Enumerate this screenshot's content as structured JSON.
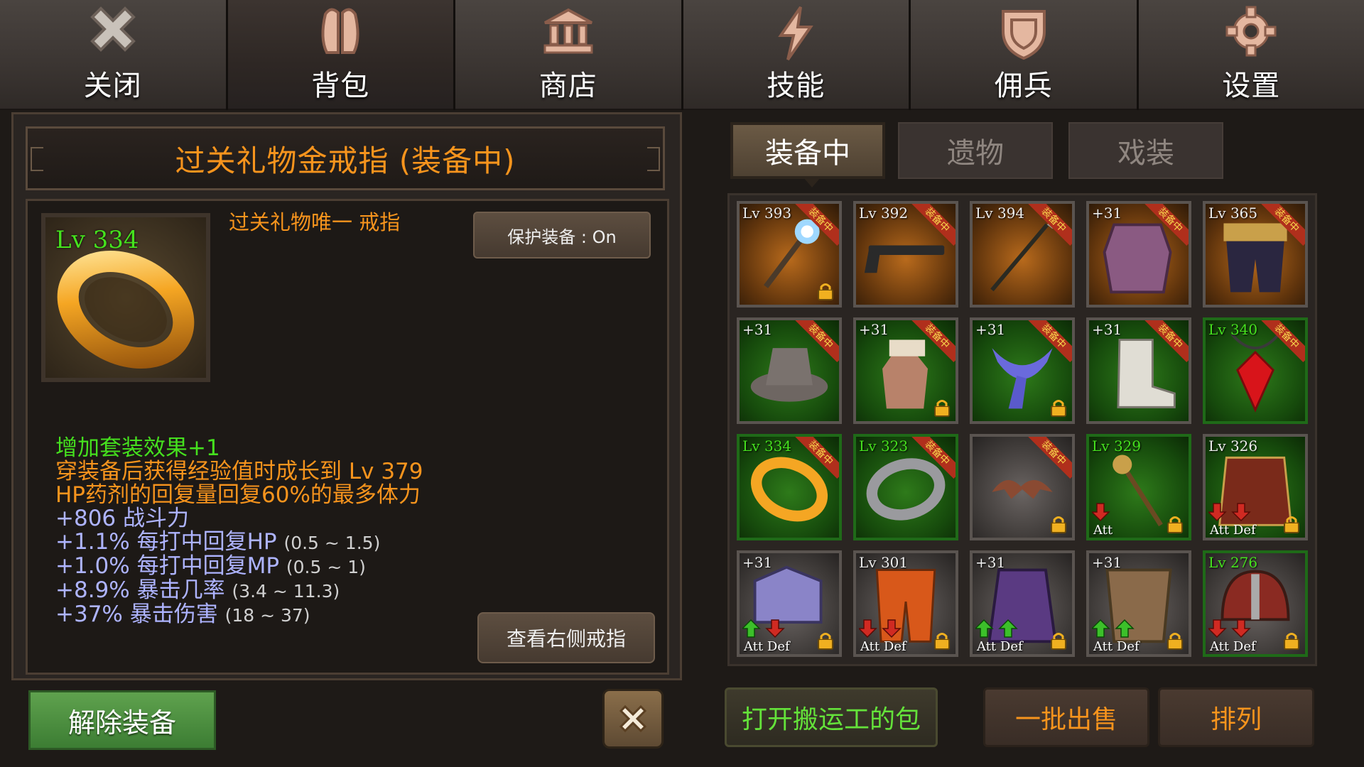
{
  "nav": [
    {
      "label": "关闭",
      "icon": "close-icon"
    },
    {
      "label": "背包",
      "icon": "backpack-icon"
    },
    {
      "label": "商店",
      "icon": "shop-icon"
    },
    {
      "label": "技能",
      "icon": "lightning-icon"
    },
    {
      "label": "佣兵",
      "icon": "shield-icon"
    },
    {
      "label": "设置",
      "icon": "gear-icon"
    }
  ],
  "item": {
    "title": "过关礼物金戒指 (装备中)",
    "level": "Lv 334",
    "subtitle": "过关礼物唯一 戒指",
    "protect_label": "保护装备 : On",
    "stats": [
      {
        "text": "增加套装效果+1",
        "range": "",
        "color": "green"
      },
      {
        "text": "穿装备后获得经验值时成长到 Lv 379",
        "range": "",
        "color": "orange"
      },
      {
        "text": "HP药剂的回复量回复60%的最多体力",
        "range": "",
        "color": "orange"
      },
      {
        "text": "+806 战斗力",
        "range": "",
        "color": "blue"
      },
      {
        "text": "+1.1% 每打中回复HP",
        "range": "(0.5 ~ 1.5)",
        "color": "blue"
      },
      {
        "text": "+1.0% 每打中回复MP",
        "range": "(0.5 ~ 1)",
        "color": "blue"
      },
      {
        "text": "+8.9% 暴击几率",
        "range": "(3.4 ~ 11.3)",
        "color": "blue"
      },
      {
        "text": "+37% 暴击伤害",
        "range": "(18 ~ 37)",
        "color": "blue"
      }
    ],
    "view_right_label": "查看右侧戒指",
    "unequip_label": "解除装备"
  },
  "tabs": [
    {
      "label": "装备中",
      "active": true
    },
    {
      "label": "遗物",
      "active": false
    },
    {
      "label": "戏装",
      "active": false
    }
  ],
  "equipped_badge": "装备中",
  "slots": [
    {
      "level": "Lv 393",
      "lv_green": false,
      "badge": true,
      "lock": true,
      "icon": "magic-staff-icon",
      "bg": "orange",
      "border": "gray",
      "att": "",
      "def": ""
    },
    {
      "level": "Lv 392",
      "lv_green": false,
      "badge": true,
      "lock": false,
      "icon": "shotgun-icon",
      "bg": "orange",
      "border": "gray",
      "att": "",
      "def": ""
    },
    {
      "level": "Lv 394",
      "lv_green": false,
      "badge": true,
      "lock": false,
      "icon": "spear-icon",
      "bg": "orange",
      "border": "gray",
      "att": "",
      "def": ""
    },
    {
      "level": "+31",
      "lv_green": false,
      "badge": true,
      "lock": false,
      "icon": "chest-armor-icon",
      "bg": "orange",
      "border": "gray",
      "att": "",
      "def": ""
    },
    {
      "level": "Lv 365",
      "lv_green": false,
      "badge": true,
      "lock": false,
      "icon": "belt-pants-icon",
      "bg": "orange",
      "border": "gray",
      "att": "",
      "def": ""
    },
    {
      "level": "+31",
      "lv_green": false,
      "badge": true,
      "lock": false,
      "icon": "hat-icon",
      "bg": "green",
      "border": "gray",
      "att": "",
      "def": ""
    },
    {
      "level": "+31",
      "lv_green": false,
      "badge": true,
      "lock": true,
      "icon": "gloves-icon",
      "bg": "green",
      "border": "gray",
      "att": "",
      "def": ""
    },
    {
      "level": "+31",
      "lv_green": false,
      "badge": true,
      "lock": true,
      "icon": "scarf-icon",
      "bg": "green",
      "border": "gray",
      "att": "",
      "def": ""
    },
    {
      "level": "+31",
      "lv_green": false,
      "badge": true,
      "lock": false,
      "icon": "boots-icon",
      "bg": "green",
      "border": "gray",
      "att": "",
      "def": ""
    },
    {
      "level": "Lv 340",
      "lv_green": true,
      "badge": true,
      "lock": false,
      "icon": "red-gem-necklace-icon",
      "bg": "green",
      "border": "green",
      "att": "",
      "def": ""
    },
    {
      "level": "Lv 334",
      "lv_green": true,
      "badge": true,
      "lock": false,
      "icon": "gold-ring-icon",
      "bg": "green",
      "border": "green",
      "att": "",
      "def": ""
    },
    {
      "level": "Lv 323",
      "lv_green": true,
      "badge": true,
      "lock": false,
      "icon": "silver-ring-icon",
      "bg": "green",
      "border": "green",
      "att": "",
      "def": ""
    },
    {
      "level": "",
      "lv_green": false,
      "badge": true,
      "lock": true,
      "icon": "bat-wings-icon",
      "bg": "gray",
      "border": "gray",
      "att": "",
      "def": ""
    },
    {
      "level": "Lv 329",
      "lv_green": true,
      "badge": false,
      "lock": true,
      "icon": "mace-staff-icon",
      "bg": "green",
      "border": "green",
      "att": "Att",
      "def": "",
      "att_dir": "down"
    },
    {
      "level": "Lv 326",
      "lv_green": false,
      "badge": false,
      "lock": true,
      "icon": "red-coat-icon",
      "bg": "green",
      "border": "gray",
      "att": "Att",
      "def": "Def",
      "att_dir": "down",
      "def_dir": "down"
    },
    {
      "level": "+31",
      "lv_green": false,
      "badge": false,
      "lock": true,
      "icon": "shoulder-armor-icon",
      "bg": "gray",
      "border": "gray",
      "att": "Att",
      "def": "Def",
      "att_dir": "up",
      "def_dir": "down"
    },
    {
      "level": "Lv 301",
      "lv_green": false,
      "badge": false,
      "lock": true,
      "icon": "orange-pants-icon",
      "bg": "gray",
      "border": "gray",
      "att": "Att",
      "def": "Def",
      "att_dir": "down",
      "def_dir": "down"
    },
    {
      "level": "+31",
      "lv_green": false,
      "badge": false,
      "lock": true,
      "icon": "purple-robe-icon",
      "bg": "gray",
      "border": "gray",
      "att": "Att",
      "def": "Def",
      "att_dir": "up",
      "def_dir": "up"
    },
    {
      "level": "+31",
      "lv_green": false,
      "badge": false,
      "lock": true,
      "icon": "leather-armor-icon",
      "bg": "gray",
      "border": "gray",
      "att": "Att",
      "def": "Def",
      "att_dir": "up",
      "def_dir": "up"
    },
    {
      "level": "Lv 276",
      "lv_green": true,
      "badge": false,
      "lock": true,
      "icon": "helmet-icon",
      "bg": "gray",
      "border": "green",
      "att": "Att",
      "def": "Def",
      "att_dir": "down",
      "def_dir": "down"
    }
  ],
  "bottom": {
    "porter_label": "打开搬运工的包",
    "sell_label": "一批出售",
    "sort_label": "排列"
  },
  "colors": {
    "orange": "#f7941d",
    "green": "#45e01e",
    "blue": "#aeb4ff",
    "badge": "#b02f1c"
  }
}
